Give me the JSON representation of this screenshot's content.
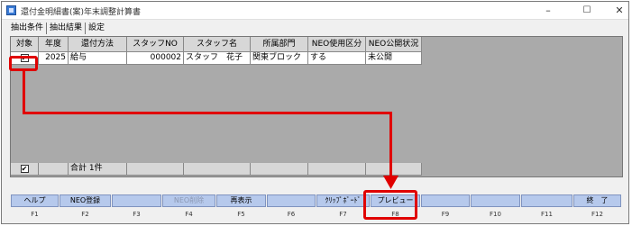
{
  "window": {
    "title": "還付金明細書(案)年末調整計算書"
  },
  "tabs": [
    "抽出条件",
    "抽出結果",
    "設定"
  ],
  "grid": {
    "columns": [
      "対象",
      "年度",
      "還付方法",
      "スタッフNO",
      "スタッフ名",
      "所属部門",
      "NEO使用区分",
      "NEO公開状況"
    ],
    "rows": [
      {
        "check": "✔",
        "year": "2025",
        "method": "給与",
        "staff_no": "000002",
        "staff_name": "スタッフ　花子",
        "dept": "関東ブロック",
        "neo_use": "する",
        "neo_pub": "未公開"
      }
    ],
    "footer": {
      "check": "✔",
      "total": "合計 1件"
    }
  },
  "fkeys": [
    {
      "label": "ヘルプ",
      "key": "F1"
    },
    {
      "label": "NEO登録",
      "key": "F2"
    },
    {
      "label": "",
      "key": "F3"
    },
    {
      "label": "NEO削除",
      "key": "F4"
    },
    {
      "label": "再表示",
      "key": "F5"
    },
    {
      "label": "",
      "key": "F6"
    },
    {
      "label": "ｸﾘｯﾌﾟﾎﾞｰﾄﾞ",
      "key": "F7"
    },
    {
      "label": "プレビュー",
      "key": "F8"
    },
    {
      "label": "",
      "key": "F9"
    },
    {
      "label": "",
      "key": "F10"
    },
    {
      "label": "",
      "key": "F11"
    },
    {
      "label": "終　了",
      "key": "F12"
    }
  ],
  "colors": {
    "highlight": "#e00000",
    "fkey_bg": "#b6c9ec"
  }
}
